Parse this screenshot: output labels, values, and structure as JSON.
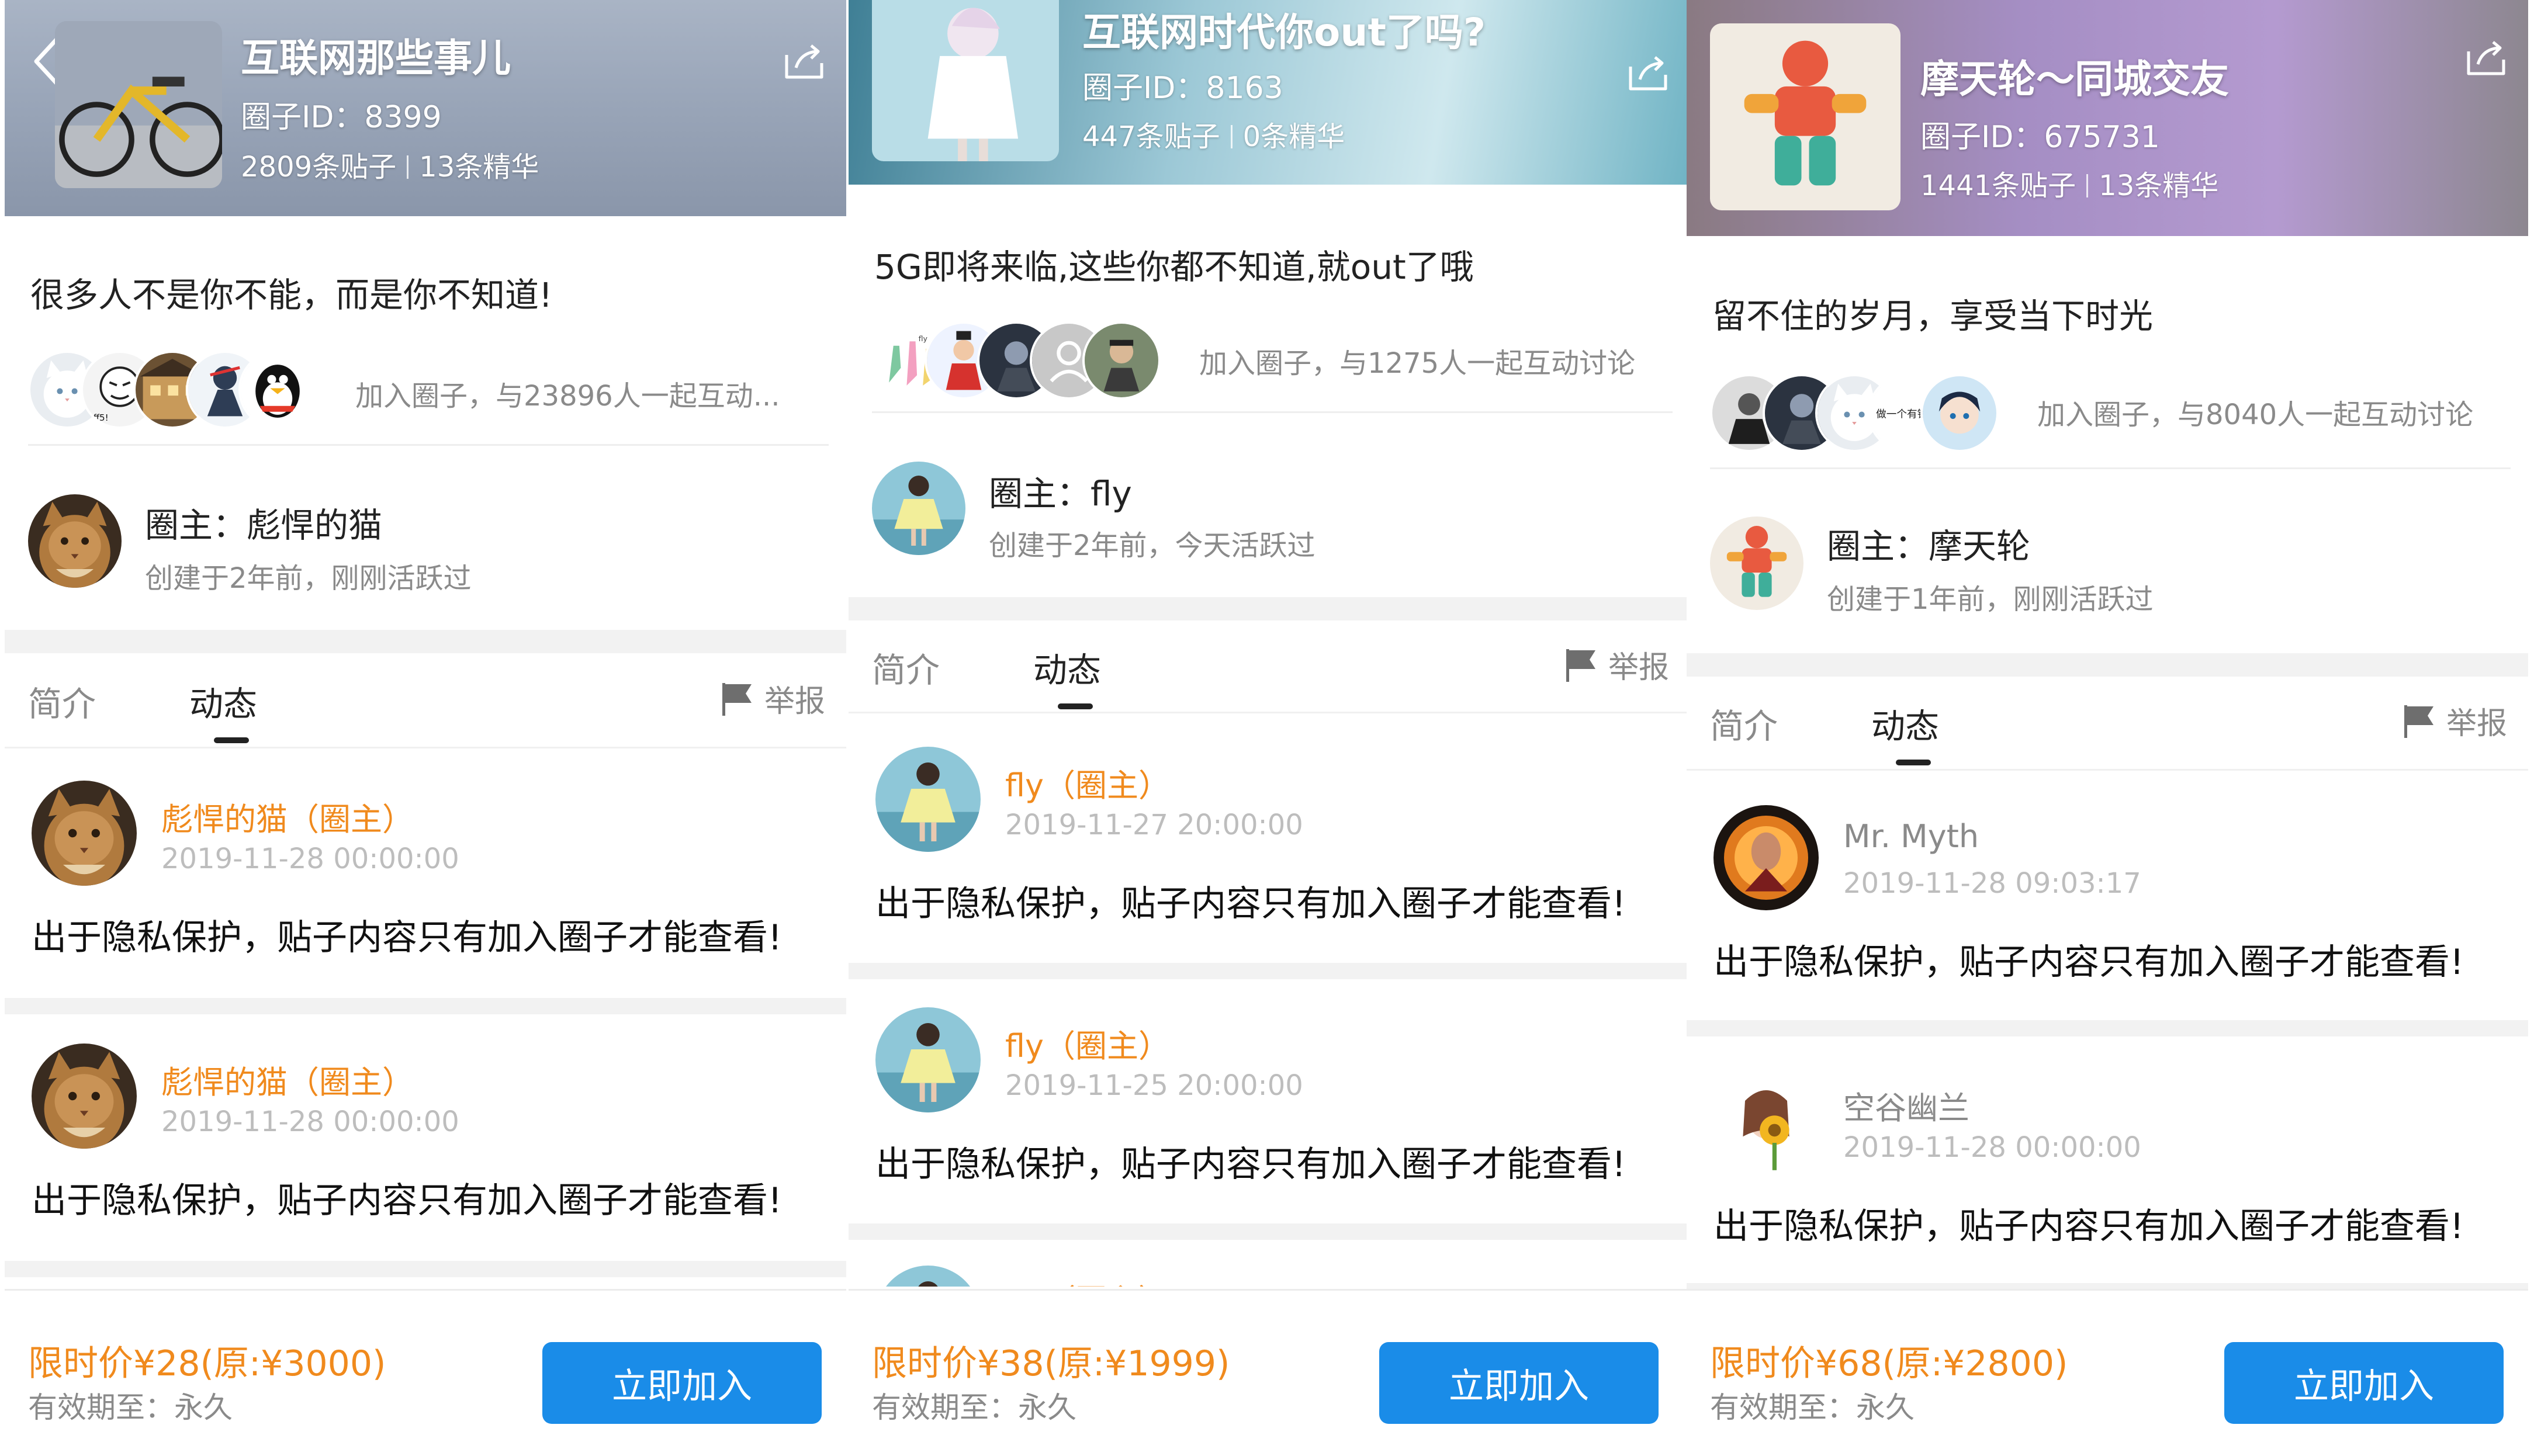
{
  "panels": [
    {
      "header": {
        "title": "互联网那些事儿",
        "id_text": "圈子ID：8399",
        "posts_count": "2809条贴子",
        "essence_count": "13条精华"
      },
      "slogan": "很多人不是你不能，而是你不知道!",
      "join_text": "加入圈子，与23896人一起互动...",
      "owner": {
        "name": "圈主：彪悍的猫",
        "meta": "创建于2年前，刚刚活跃过"
      },
      "tabs": {
        "intro": "简介",
        "feed": "动态",
        "report": "举报"
      },
      "posts": [
        {
          "author": "彪悍的猫（圈主）",
          "time": "2019-11-28 00:00:00",
          "body": "出于隐私保护，贴子内容只有加入圈子才能查看!"
        },
        {
          "author": "彪悍的猫（圈主）",
          "time": "2019-11-28 00:00:00",
          "body": "出于隐私保护，贴子内容只有加入圈子才能查看!"
        }
      ],
      "bottom": {
        "price": "限时价¥28(原:¥3000)",
        "validity": "有效期至：永久",
        "join_button": "立即加入"
      }
    },
    {
      "header": {
        "title": "互联网时代你out了吗?",
        "id_text": "圈子ID：8163",
        "posts_count": "447条贴子",
        "essence_count": "0条精华"
      },
      "slogan": "5G即将来临,这些你都不知道,就out了哦",
      "join_text": "加入圈子，与1275人一起互动讨论",
      "owner": {
        "name": "圈主：fly",
        "meta": "创建于2年前，今天活跃过"
      },
      "tabs": {
        "intro": "简介",
        "feed": "动态",
        "report": "举报"
      },
      "posts": [
        {
          "author": "fly（圈主）",
          "time": "2019-11-27 20:00:00",
          "body": "出于隐私保护，贴子内容只有加入圈子才能查看!"
        },
        {
          "author": "fly（圈主）",
          "time": "2019-11-25 20:00:00",
          "body": "出于隐私保护，贴子内容只有加入圈子才能查看!"
        },
        {
          "author": "fly（圈主）",
          "time": "",
          "body": ""
        }
      ],
      "bottom": {
        "price": "限时价¥38(原:¥1999)",
        "validity": "有效期至：永久",
        "join_button": "立即加入"
      }
    },
    {
      "header": {
        "title": "摩天轮～同城交友",
        "id_text": "圈子ID：675731",
        "posts_count": "1441条贴子",
        "essence_count": "13条精华"
      },
      "slogan": "留不住的岁月，享受当下时光",
      "join_text": "加入圈子，与8040人一起互动讨论",
      "owner": {
        "name": "圈主：摩天轮",
        "meta": "创建于1年前，刚刚活跃过"
      },
      "tabs": {
        "intro": "简介",
        "feed": "动态",
        "report": "举报"
      },
      "posts": [
        {
          "author": "Mr. Myth",
          "time": "2019-11-28 09:03:17",
          "body": "出于隐私保护，贴子内容只有加入圈子才能查看!"
        },
        {
          "author": "空谷幽兰",
          "time": "2019-11-28 00:00:00",
          "body": "出于隐私保护，贴子内容只有加入圈子才能查看!"
        }
      ],
      "bottom": {
        "price": "限时价¥68(原:¥2800)",
        "validity": "有效期至：永久",
        "join_button": "立即加入"
      }
    }
  ],
  "colors": {
    "accent_orange": "#f08a1d",
    "button_blue": "#1a8ce8",
    "gray_text": "#8a8a8a"
  },
  "icons": [
    "back-arrow-icon",
    "share-icon",
    "report-flag-icon",
    "person-placeholder-icon"
  ]
}
